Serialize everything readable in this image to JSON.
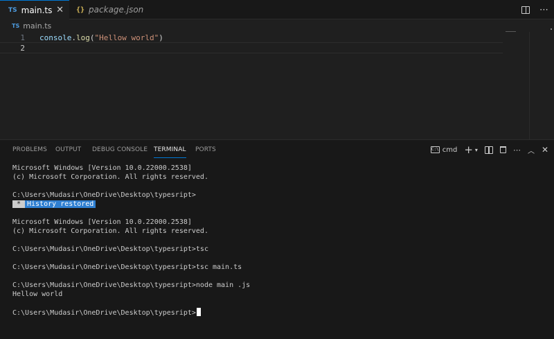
{
  "tabs": [
    {
      "badge": "TS",
      "label": "main.ts",
      "close": "✕",
      "active": true
    },
    {
      "badge": "{}",
      "label": "package.json",
      "active": false
    }
  ],
  "breadcrumb": {
    "badge": "TS",
    "file": "main.ts"
  },
  "editor": {
    "lines": [
      {
        "num": "1",
        "obj": "console",
        "dot": ".",
        "fn": "log",
        "open": "(",
        "str": "\"Hellow world\"",
        "close": ")"
      },
      {
        "num": "2"
      }
    ]
  },
  "panel": {
    "tabs": [
      "PROBLEMS",
      "OUTPUT",
      "DEBUG CONSOLE",
      "TERMINAL",
      "PORTS"
    ],
    "active_tab": "TERMINAL",
    "shell_label": "cmd",
    "shell_icon_text": "C:\\",
    "icons": [
      "terminal-icon",
      "plus-icon",
      "chevron-down-icon",
      "split-icon",
      "trash-icon",
      "ellipsis-icon",
      "chevron-up-icon",
      "close-icon"
    ]
  },
  "terminal": {
    "lines": [
      "Microsoft Windows [Version 10.0.22000.2538]",
      "(c) Microsoft Corporation. All rights reserved.",
      "",
      "C:\\Users\\Mudasir\\OneDrive\\Desktop\\typesript>",
      "",
      "",
      "Microsoft Windows [Version 10.0.22000.2538]",
      "(c) Microsoft Corporation. All rights reserved.",
      "",
      "C:\\Users\\Mudasir\\OneDrive\\Desktop\\typesript>tsc",
      "",
      "C:\\Users\\Mudasir\\OneDrive\\Desktop\\typesript>tsc main.ts",
      "",
      "C:\\Users\\Mudasir\\OneDrive\\Desktop\\typesript>node main .js",
      "Hellow world",
      "",
      "C:\\Users\\Mudasir\\OneDrive\\Desktop\\typesript>"
    ],
    "restored_star": "*",
    "restored_message": "History restored"
  },
  "colors": {
    "accent": "#0078d4",
    "restored_bg": "#2f7fd1"
  }
}
